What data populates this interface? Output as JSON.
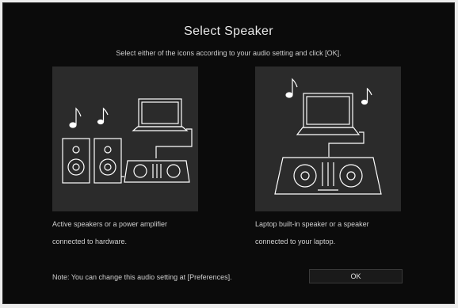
{
  "dialog": {
    "title": "Select Speaker",
    "subtitle": "Select either of the icons according to your audio setting and click [OK]."
  },
  "options": [
    {
      "caption_line1": "Active speakers or a power amplifier",
      "caption_line2": "connected to hardware."
    },
    {
      "caption_line1": "Laptop built-in speaker or a speaker",
      "caption_line2": "connected to your laptop."
    }
  ],
  "note": "Note: You can change this audio setting at [Preferences].",
  "ok_label": "OK",
  "colors": {
    "background": "#0b0b0b",
    "panel": "#2b2b2b",
    "line_art": "#ffffff"
  }
}
